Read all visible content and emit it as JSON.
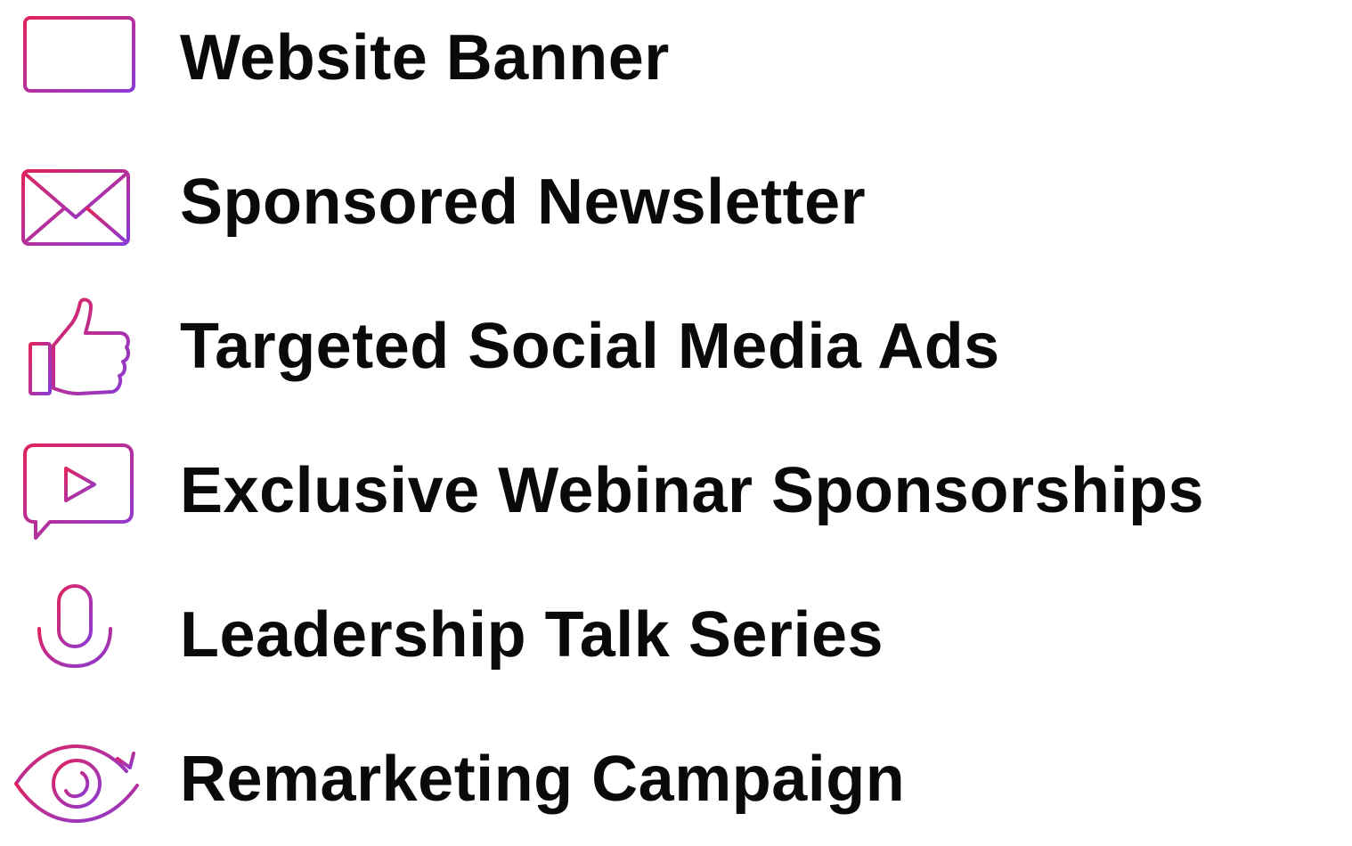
{
  "accent_gradient": {
    "start": "#e0245e",
    "end": "#8a3bd6"
  },
  "items": [
    {
      "icon": "monitor-icon",
      "label": "Website Banner"
    },
    {
      "icon": "envelope-icon",
      "label": "Sponsored Newsletter"
    },
    {
      "icon": "thumbs-up-icon",
      "label": "Targeted Social Media Ads"
    },
    {
      "icon": "video-chat-play-icon",
      "label": "Exclusive Webinar Sponsorships"
    },
    {
      "icon": "microphone-icon",
      "label": "Leadership Talk Series"
    },
    {
      "icon": "eye-refresh-icon",
      "label": "Remarketing Campaign"
    }
  ]
}
